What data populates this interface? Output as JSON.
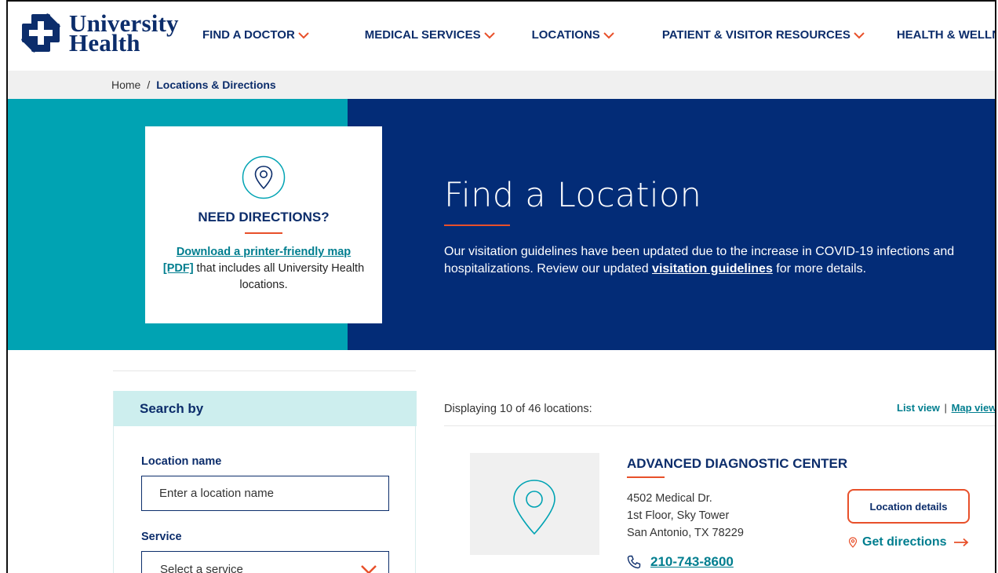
{
  "brand": {
    "logo_line1": "University",
    "logo_line2": "Health",
    "navy": "#0c2d6b",
    "teal": "#00a3b3",
    "accent": "#e8502a"
  },
  "nav": {
    "items": [
      {
        "label": "FIND A DOCTOR"
      },
      {
        "label": "MEDICAL SERVICES"
      },
      {
        "label": "LOCATIONS"
      },
      {
        "label": "PATIENT & VISITOR RESOURCES"
      },
      {
        "label": "HEALTH & WELLNESS"
      }
    ]
  },
  "breadcrumb": {
    "home": "Home",
    "separator": "/",
    "current": "Locations & Directions"
  },
  "directions_card": {
    "icon": "location-pin-icon",
    "title": "NEED DIRECTIONS?",
    "link_text": "Download a printer-friendly map",
    "pdf_label": "[PDF]",
    "rest_text": " that includes all University Health locations."
  },
  "hero": {
    "title": "Find a Location",
    "desc_before": "Our visitation guidelines have been updated due to the increase in COVID-19 infections and hospitalizations. Review our updated ",
    "desc_link": "visitation guidelines",
    "desc_after": " for more details."
  },
  "search": {
    "heading": "Search by",
    "location_label": "Location name",
    "location_placeholder": "Enter a location name",
    "service_label": "Service",
    "service_value": "Select a service"
  },
  "results": {
    "summary": "Displaying 10 of 46 locations:",
    "list_view": "List view",
    "view_sep": "|",
    "map_view": "Map view"
  },
  "location": {
    "name": "ADVANCED DIAGNOSTIC CENTER",
    "address_line1": "4502 Medical Dr.",
    "address_line2": "1st Floor, Sky Tower",
    "address_line3": "San Antonio, TX 78229",
    "phone": "210-743-8600",
    "details_button": "Location details",
    "directions_link": "Get directions"
  }
}
